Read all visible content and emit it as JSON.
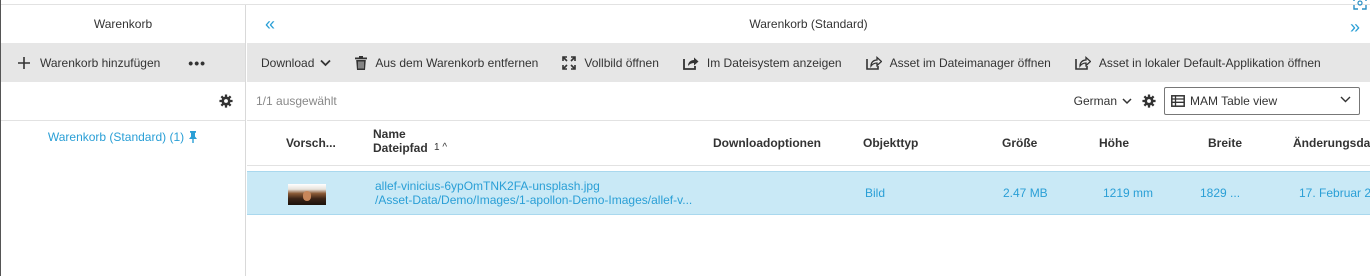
{
  "left_panel": {
    "title": "Warenkorb",
    "add_label": "Warenkorb hinzufügen",
    "more_label": "•••",
    "list_item": "Warenkorb (Standard) (1)"
  },
  "right_panel": {
    "title": "Warenkorb (Standard)",
    "collapse_glyph": "«",
    "expand_glyph": "»"
  },
  "toolbar": {
    "download": "Download",
    "remove": "Aus dem Warenkorb entfernen",
    "fullscreen": "Vollbild öffnen",
    "show_in_fs": "Im Dateisystem anzeigen",
    "open_in_fm": "Asset im Dateimanager öffnen",
    "open_in_default_app": "Asset in lokaler Default-Applikation öffnen"
  },
  "subbar": {
    "selection": "1/1 ausgewählt",
    "language": "German",
    "view": "MAM Table view"
  },
  "table": {
    "headers": {
      "preview": "Vorsch...",
      "name": "Name",
      "path": "Dateipfad",
      "sort": "1 ^",
      "download_options": "Downloadoptionen",
      "type": "Objekttyp",
      "size": "Größe",
      "height": "Höhe",
      "width": "Breite",
      "modified": "Änderungsda"
    },
    "rows": [
      {
        "name": "allef-vinicius-6ypOmTNK2FA-unsplash.jpg",
        "path": "/Asset-Data/Demo/Images/1-apollon-Demo-Images/allef-v...",
        "type": "Bild",
        "size": "2.47 MB",
        "height": "1219 mm",
        "width": "1829 ...",
        "modified": "17. Februar 2"
      }
    ]
  },
  "colors": {
    "accent": "#2a9fd6",
    "toolbar_bg": "#e6e6e6",
    "selected_row": "#c9e9f6"
  }
}
